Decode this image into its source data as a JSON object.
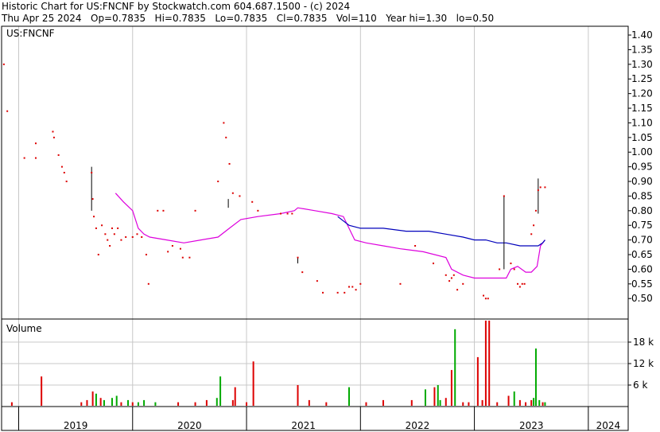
{
  "header": {
    "line1": "Historic Chart for US:FNCNF by Stockwatch.com 604.687.1500 - (c) 2024",
    "line2": "Thu Apr 25 2024   Op=0.7835   Hi=0.7835   Lo=0.7835   Cl=0.7835   Vol=110   Year hi=1.30   lo=0.50"
  },
  "colors": {
    "price": "#dd0000",
    "ma_short": "#dd00dd",
    "ma_long": "#0000bb",
    "volume_down": "#dd0000",
    "volume_up": "#00aa00",
    "grid": "#c8c8c8",
    "axis": "#000000"
  },
  "chart_data": [
    {
      "type": "scatter",
      "title": "US:FNCNF",
      "x_axis": {
        "ticks": [
          "2019",
          "2020",
          "2021",
          "2022",
          "2023",
          "2024"
        ],
        "range": [
          2018.85,
          2024.35
        ]
      },
      "ylim": [
        0.43,
        1.43
      ],
      "yticks": [
        "0.50",
        "0.55",
        "0.60",
        "0.65",
        "0.70",
        "0.75",
        "0.80",
        "0.85",
        "0.90",
        "0.95",
        "1.00",
        "1.05",
        "1.10",
        "1.15",
        "1.20",
        "1.25",
        "1.30",
        "1.35",
        "1.40"
      ],
      "grid": true,
      "series": [
        {
          "key": "price",
          "points": [
            [
              2018.87,
              1.3
            ],
            [
              2018.9,
              1.14
            ],
            [
              2019.05,
              0.98
            ],
            [
              2019.15,
              1.03
            ],
            [
              2019.15,
              0.98
            ],
            [
              2019.3,
              1.07
            ],
            [
              2019.31,
              1.05
            ],
            [
              2019.35,
              0.99
            ],
            [
              2019.38,
              0.95
            ],
            [
              2019.4,
              0.93
            ],
            [
              2019.42,
              0.9
            ],
            [
              2019.64,
              0.93
            ],
            [
              2019.65,
              0.84
            ],
            [
              2019.66,
              0.78
            ],
            [
              2019.68,
              0.74
            ],
            [
              2019.7,
              0.65
            ],
            [
              2019.73,
              0.75
            ],
            [
              2019.76,
              0.72
            ],
            [
              2019.78,
              0.7
            ],
            [
              2019.8,
              0.68
            ],
            [
              2019.82,
              0.74
            ],
            [
              2019.84,
              0.72
            ],
            [
              2019.87,
              0.74
            ],
            [
              2019.9,
              0.7
            ],
            [
              2019.94,
              0.71
            ],
            [
              2020.0,
              0.71
            ],
            [
              2020.04,
              0.72
            ],
            [
              2020.08,
              0.71
            ],
            [
              2020.12,
              0.65
            ],
            [
              2020.14,
              0.55
            ],
            [
              2020.22,
              0.8
            ],
            [
              2020.27,
              0.8
            ],
            [
              2020.31,
              0.66
            ],
            [
              2020.35,
              0.68
            ],
            [
              2020.42,
              0.67
            ],
            [
              2020.44,
              0.64
            ],
            [
              2020.5,
              0.64
            ],
            [
              2020.55,
              0.8
            ],
            [
              2020.75,
              0.9
            ],
            [
              2020.8,
              1.1
            ],
            [
              2020.82,
              1.05
            ],
            [
              2020.85,
              0.96
            ],
            [
              2020.88,
              0.86
            ],
            [
              2020.94,
              0.85
            ],
            [
              2021.05,
              0.83
            ],
            [
              2021.1,
              0.8
            ],
            [
              2021.3,
              0.79
            ],
            [
              2021.36,
              0.79
            ],
            [
              2021.4,
              0.79
            ],
            [
              2021.45,
              0.64
            ],
            [
              2021.49,
              0.59
            ],
            [
              2021.62,
              0.56
            ],
            [
              2021.67,
              0.52
            ],
            [
              2021.8,
              0.52
            ],
            [
              2021.86,
              0.52
            ],
            [
              2021.9,
              0.54
            ],
            [
              2021.93,
              0.54
            ],
            [
              2021.96,
              0.53
            ],
            [
              2022.0,
              0.55
            ],
            [
              2022.35,
              0.55
            ],
            [
              2022.48,
              0.68
            ],
            [
              2022.64,
              0.62
            ],
            [
              2022.75,
              0.58
            ],
            [
              2022.78,
              0.56
            ],
            [
              2022.8,
              0.57
            ],
            [
              2022.82,
              0.58
            ],
            [
              2022.85,
              0.53
            ],
            [
              2022.9,
              0.55
            ],
            [
              2023.08,
              0.51
            ],
            [
              2023.1,
              0.5
            ],
            [
              2023.12,
              0.5
            ],
            [
              2023.22,
              0.6
            ],
            [
              2023.26,
              0.85
            ],
            [
              2023.32,
              0.62
            ],
            [
              2023.35,
              0.6
            ],
            [
              2023.38,
              0.55
            ],
            [
              2023.4,
              0.54
            ],
            [
              2023.42,
              0.55
            ],
            [
              2023.44,
              0.55
            ],
            [
              2023.5,
              0.72
            ],
            [
              2023.52,
              0.75
            ],
            [
              2023.54,
              0.8
            ],
            [
              2023.56,
              0.87
            ],
            [
              2023.58,
              0.88
            ],
            [
              2023.62,
              0.88
            ]
          ]
        },
        {
          "key": "ma_short",
          "points": [
            [
              2019.85,
              0.86
            ],
            [
              2019.92,
              0.83
            ],
            [
              2020.0,
              0.8
            ],
            [
              2020.05,
              0.74
            ],
            [
              2020.1,
              0.72
            ],
            [
              2020.15,
              0.71
            ],
            [
              2020.3,
              0.7
            ],
            [
              2020.45,
              0.69
            ],
            [
              2020.6,
              0.7
            ],
            [
              2020.75,
              0.71
            ],
            [
              2020.85,
              0.74
            ],
            [
              2020.95,
              0.77
            ],
            [
              2021.1,
              0.78
            ],
            [
              2021.3,
              0.79
            ],
            [
              2021.42,
              0.8
            ],
            [
              2021.45,
              0.81
            ],
            [
              2021.6,
              0.8
            ],
            [
              2021.75,
              0.79
            ],
            [
              2021.85,
              0.78
            ],
            [
              2021.95,
              0.7
            ],
            [
              2022.05,
              0.69
            ],
            [
              2022.2,
              0.68
            ],
            [
              2022.35,
              0.67
            ],
            [
              2022.55,
              0.66
            ],
            [
              2022.75,
              0.64
            ],
            [
              2022.8,
              0.6
            ],
            [
              2022.9,
              0.58
            ],
            [
              2023.0,
              0.57
            ],
            [
              2023.1,
              0.57
            ],
            [
              2023.2,
              0.57
            ],
            [
              2023.28,
              0.57
            ],
            [
              2023.32,
              0.6
            ],
            [
              2023.38,
              0.61
            ],
            [
              2023.45,
              0.59
            ],
            [
              2023.5,
              0.59
            ],
            [
              2023.55,
              0.61
            ],
            [
              2023.58,
              0.68
            ],
            [
              2023.62,
              0.7
            ]
          ]
        },
        {
          "key": "ma_long",
          "points": [
            [
              2021.8,
              0.78
            ],
            [
              2021.9,
              0.75
            ],
            [
              2022.0,
              0.74
            ],
            [
              2022.2,
              0.74
            ],
            [
              2022.4,
              0.73
            ],
            [
              2022.6,
              0.73
            ],
            [
              2022.75,
              0.72
            ],
            [
              2022.9,
              0.71
            ],
            [
              2023.0,
              0.7
            ],
            [
              2023.1,
              0.7
            ],
            [
              2023.2,
              0.69
            ],
            [
              2023.28,
              0.69
            ],
            [
              2023.4,
              0.68
            ],
            [
              2023.5,
              0.68
            ],
            [
              2023.56,
              0.68
            ],
            [
              2023.6,
              0.69
            ],
            [
              2023.62,
              0.7
            ]
          ]
        }
      ],
      "ranges": [
        [
          2019.64,
          0.8,
          0.95
        ],
        [
          2020.84,
          0.81,
          0.84
        ],
        [
          2021.45,
          0.62,
          0.64
        ],
        [
          2023.26,
          0.6,
          0.85
        ],
        [
          2023.56,
          0.79,
          0.91
        ]
      ]
    },
    {
      "type": "bar",
      "title": "Volume",
      "x_axis": {
        "range": [
          2018.85,
          2024.35
        ]
      },
      "ylim": [
        0,
        24000
      ],
      "yticks": [
        "6 k",
        "12 k",
        "18 k"
      ],
      "bars": [
        [
          2018.94,
          1200,
          "down"
        ],
        [
          2019.2,
          8400,
          "down"
        ],
        [
          2019.55,
          1200,
          "down"
        ],
        [
          2019.6,
          1800,
          "down"
        ],
        [
          2019.65,
          4200,
          "down"
        ],
        [
          2019.68,
          3600,
          "up"
        ],
        [
          2019.72,
          2400,
          "down"
        ],
        [
          2019.75,
          1800,
          "up"
        ],
        [
          2019.82,
          2400,
          "up"
        ],
        [
          2019.86,
          3000,
          "up"
        ],
        [
          2019.9,
          1200,
          "down"
        ],
        [
          2019.96,
          1800,
          "up"
        ],
        [
          2020.0,
          1200,
          "down"
        ],
        [
          2020.05,
          1200,
          "up"
        ],
        [
          2020.1,
          1800,
          "up"
        ],
        [
          2020.2,
          1200,
          "up"
        ],
        [
          2020.4,
          1200,
          "down"
        ],
        [
          2020.55,
          1200,
          "down"
        ],
        [
          2020.65,
          1800,
          "down"
        ],
        [
          2020.74,
          2400,
          "up"
        ],
        [
          2020.77,
          8400,
          "up"
        ],
        [
          2020.88,
          1800,
          "down"
        ],
        [
          2020.9,
          5400,
          "down"
        ],
        [
          2021.0,
          1200,
          "down"
        ],
        [
          2021.06,
          12600,
          "down"
        ],
        [
          2021.45,
          6000,
          "down"
        ],
        [
          2021.55,
          1800,
          "down"
        ],
        [
          2021.7,
          1200,
          "down"
        ],
        [
          2021.9,
          5400,
          "up"
        ],
        [
          2022.05,
          1200,
          "down"
        ],
        [
          2022.2,
          1800,
          "down"
        ],
        [
          2022.45,
          1800,
          "down"
        ],
        [
          2022.57,
          4800,
          "up"
        ],
        [
          2022.65,
          5400,
          "down"
        ],
        [
          2022.68,
          6000,
          "up"
        ],
        [
          2022.7,
          1800,
          "up"
        ],
        [
          2022.75,
          2400,
          "down"
        ],
        [
          2022.8,
          10200,
          "down"
        ],
        [
          2022.83,
          21600,
          "up"
        ],
        [
          2022.9,
          1200,
          "down"
        ],
        [
          2022.95,
          1200,
          "down"
        ],
        [
          2023.03,
          13800,
          "down"
        ],
        [
          2023.07,
          1800,
          "down"
        ],
        [
          2023.1,
          24000,
          "down"
        ],
        [
          2023.13,
          24000,
          "down"
        ],
        [
          2023.2,
          1200,
          "down"
        ],
        [
          2023.3,
          3000,
          "down"
        ],
        [
          2023.35,
          4200,
          "up"
        ],
        [
          2023.4,
          1800,
          "down"
        ],
        [
          2023.45,
          1200,
          "down"
        ],
        [
          2023.5,
          1800,
          "down"
        ],
        [
          2023.52,
          2400,
          "up"
        ],
        [
          2023.54,
          16200,
          "up"
        ],
        [
          2023.57,
          1800,
          "up"
        ],
        [
          2023.6,
          1200,
          "down"
        ],
        [
          2023.62,
          1200,
          "up"
        ]
      ]
    }
  ]
}
